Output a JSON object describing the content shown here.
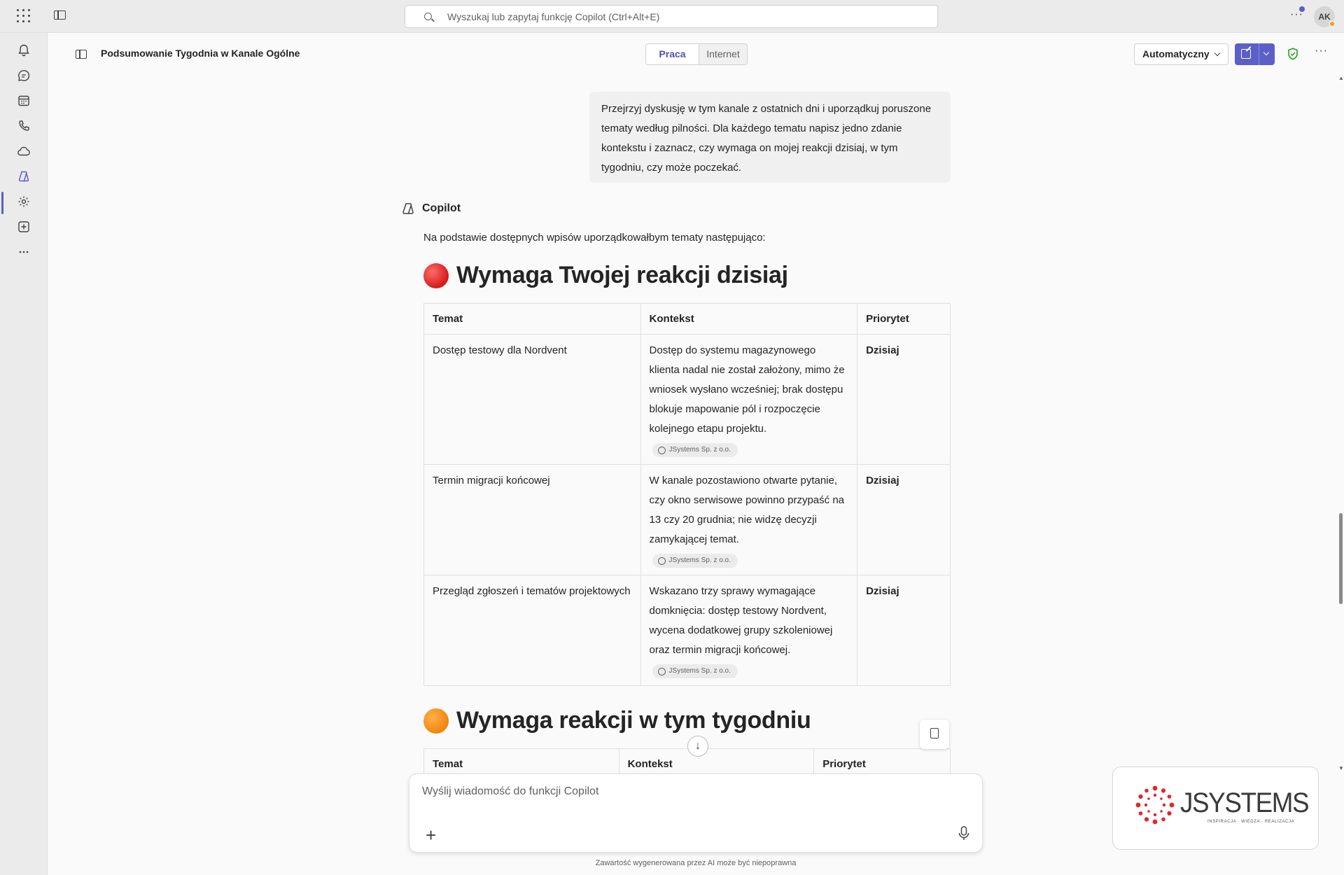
{
  "search": {
    "placeholder": "Wyszukaj lub zapytaj funkcję Copilot (Ctrl+Alt+E)"
  },
  "user": {
    "initials": "AK"
  },
  "rail": {
    "icons": [
      "bell-icon",
      "chat-icon",
      "calendar-icon",
      "phone-icon",
      "cloud-icon",
      "copilot-icon",
      "apps-settings-icon",
      "add-app-icon",
      "more-icon"
    ],
    "active": "copilot-icon"
  },
  "header": {
    "title": "Podsumowanie Tygodnia w Kanale Ogólne",
    "toggle": {
      "work": "Praca",
      "web": "Internet",
      "selected": "Praca"
    },
    "mode": "Automatyczny"
  },
  "colors": {
    "accent": "#5b5fc7",
    "accent_text": "#4f52b2",
    "shield": "#13a10e",
    "red_dot": "#d41b1b",
    "orange_dot": "#f0860c"
  },
  "conversation": {
    "user_prompt": "Przejrzyj dyskusję w tym kanale z ostatnich dni i uporządkuj poruszone tematy według pilności. Dla każdego tematu napisz jedno zdanie kontekstu i zaznacz, czy wymaga on mojej reakcji dzisiaj, w tym tygodniu, czy może poczekać.",
    "assistant_name": "Copilot",
    "intro": "Na podstawie dostępnych wpisów uporządkowałbym tematy następująco:",
    "sections": [
      {
        "heading": "Wymaga Twojej reakcji dzisiaj",
        "columns": [
          "Temat",
          "Kontekst",
          "Priorytet"
        ],
        "rows": [
          {
            "topic": "Dostęp testowy dla Nordvent",
            "context": "Dostęp do systemu magazynowego klienta nadal nie został założony, mimo że wniosek wysłano wcześniej; brak dostępu blokuje mapowanie pól i rozpoczęcie kolejnego etapu projektu.",
            "citation": "JSystems Sp. z o.o.",
            "priority": "Dzisiaj"
          },
          {
            "topic": "Termin migracji końcowej",
            "context": "W kanale pozostawiono otwarte pytanie, czy okno serwisowe powinno przypaść na 13 czy 20 grudnia; nie widzę decyzji zamykającej temat.",
            "citation": "JSystems Sp. z o.o.",
            "priority": "Dzisiaj"
          },
          {
            "topic": "Przegląd zgłoszeń i tematów projektowych",
            "context": "Wskazano trzy sprawy wymagające domknięcia: dostęp testowy Nordvent, wycena dodatkowej grupy szkoleniowej oraz termin migracji końcowej.",
            "citation": "JSystems Sp. z o.o.",
            "priority": "Dzisiaj"
          }
        ]
      },
      {
        "heading": "Wymaga reakcji w tym tygodniu",
        "columns": [
          "Temat",
          "Kontekst",
          "Priorytet"
        ]
      }
    ]
  },
  "composer": {
    "placeholder": "Wyślij wiadomość do funkcji Copilot"
  },
  "disclaimer": "Zawartość wygenerowana przez AI może być niepoprawna",
  "logo": {
    "name": "JSYSTEMS",
    "tagline": "INSPIRACJA · WIEDZA · REALIZACJA"
  }
}
